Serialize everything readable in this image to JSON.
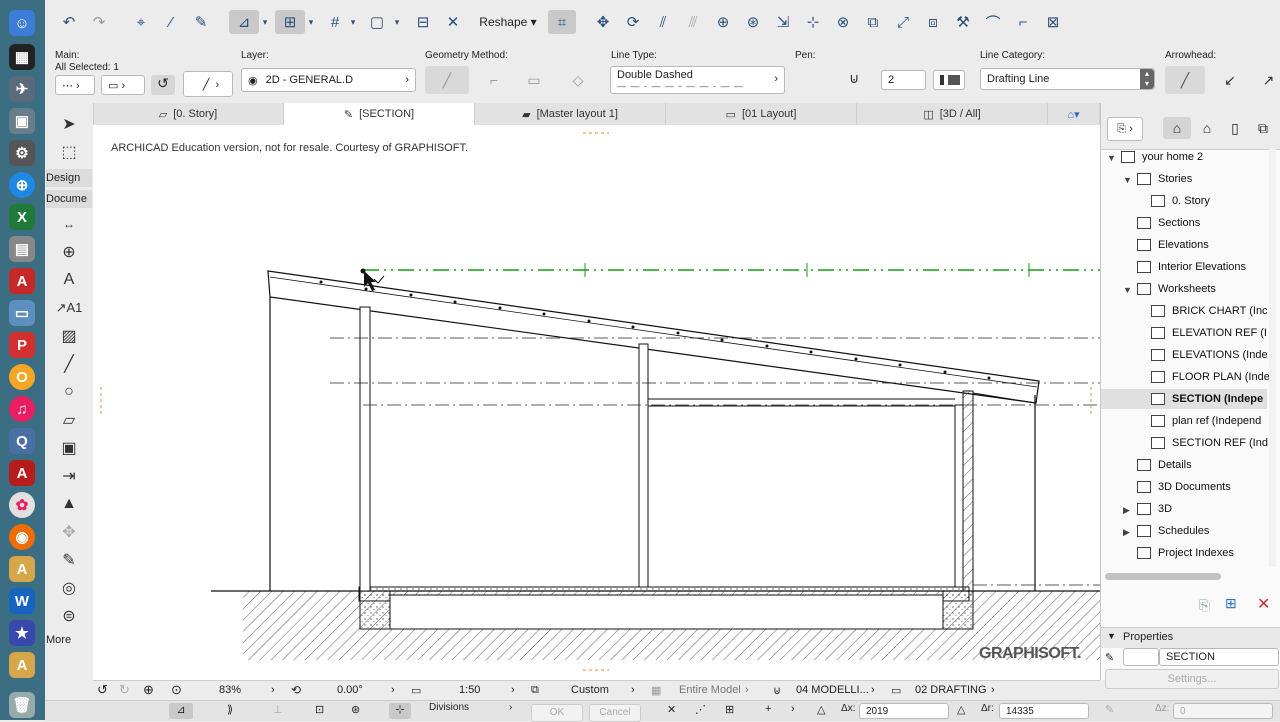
{
  "infobox": {
    "main_label": "Main:",
    "selection_text": "All Selected: 1",
    "layer_label": "Layer:",
    "layer_value": "2D - GENERAL.D",
    "geometry_label": "Geometry Method:",
    "linetype_label": "Line Type:",
    "linetype_value": "Double Dashed",
    "pen_label": "Pen:",
    "pen_value": "2",
    "linecat_label": "Line Category:",
    "linecat_value": "Drafting Line",
    "arrowhead_label": "Arrowhead:"
  },
  "toolbar": {
    "reshape_label": "Reshape"
  },
  "tabs": [
    {
      "label": "[0. Story]"
    },
    {
      "label": "[SECTION]"
    },
    {
      "label": "[Master layout 1]"
    },
    {
      "label": "[01 Layout]"
    },
    {
      "label": "[3D / All]"
    }
  ],
  "toolbox": {
    "design_label": "Design",
    "document_label": "Docume",
    "more_label": "More"
  },
  "canvas": {
    "watermark": "ARCHICAD Education version, not for resale. Courtesy of GRAPHISOFT.",
    "brand": "GRAPHISOFT."
  },
  "navigator": {
    "items": [
      {
        "label": "your home 2"
      },
      {
        "label": "Stories"
      },
      {
        "label": "0. Story"
      },
      {
        "label": "Sections"
      },
      {
        "label": "Elevations"
      },
      {
        "label": "Interior Elevations"
      },
      {
        "label": "Worksheets"
      },
      {
        "label": "BRICK CHART (Inc"
      },
      {
        "label": "ELEVATION REF (I"
      },
      {
        "label": "ELEVATIONS (Inde"
      },
      {
        "label": "FLOOR PLAN (Inde"
      },
      {
        "label": "SECTION (Indepe"
      },
      {
        "label": "plan ref (Independ"
      },
      {
        "label": "SECTION REF (Ind"
      },
      {
        "label": "Details"
      },
      {
        "label": "3D Documents"
      },
      {
        "label": "3D"
      },
      {
        "label": "Schedules"
      },
      {
        "label": "Project Indexes"
      }
    ],
    "properties_title": "Properties",
    "properties_value": "SECTION",
    "settings_label": "Settings..."
  },
  "status": {
    "zoom": "83%",
    "angle": "0.00°",
    "scale": "1:50",
    "override": "Custom",
    "model_filter": "Entire Model",
    "pen_set": "04 MODELLI...",
    "drafting": "02 DRAFTING"
  },
  "bottom": {
    "divisions_label": "Divisions",
    "ok_label": "OK",
    "cancel_label": "Cancel",
    "dx_label": "Δx:",
    "dx_value": "2019",
    "dr_label": "Δr:",
    "dr_value": "14335",
    "dz_label": "Δz:",
    "dz_value": "0"
  }
}
